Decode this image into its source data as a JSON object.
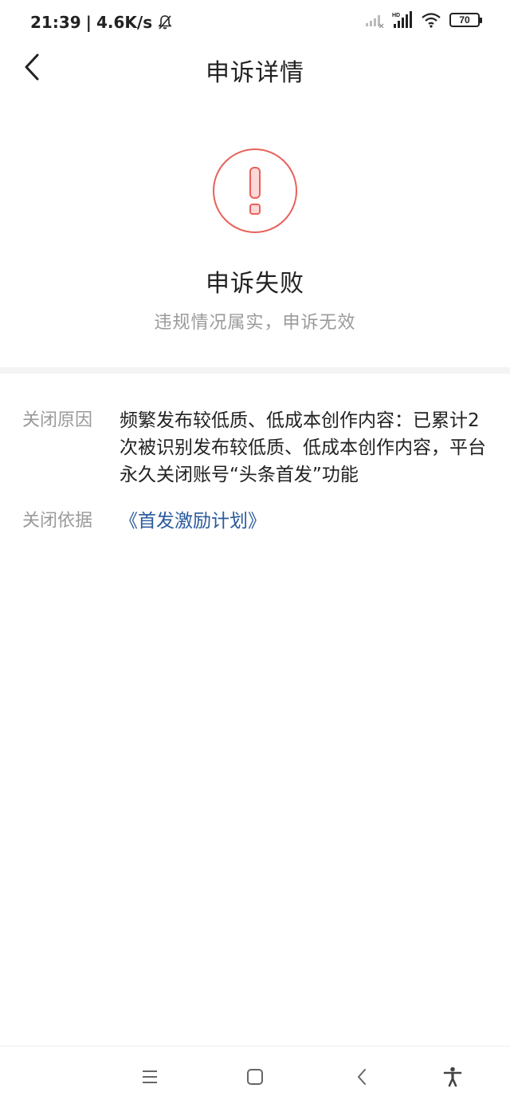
{
  "status_bar": {
    "time": "21:39",
    "separator": "|",
    "network_speed": "4.6K/s",
    "battery_level": "70",
    "icons": [
      "bell-off-icon",
      "signal-icon",
      "hd-signal-icon",
      "wifi-icon",
      "battery-icon"
    ]
  },
  "nav": {
    "title": "申诉详情",
    "back_icon": "chevron-left-icon"
  },
  "result": {
    "icon": "exclamation-icon",
    "title": "申诉失败",
    "subtitle": "违规情况属实，申诉无效",
    "accent_color": "#e8615c"
  },
  "details": {
    "reason_label": "关闭原因",
    "reason_text": "频繁发布较低质、低成本创作内容：已累计2次被识别发布较低质、低成本创作内容，平台永久关闭账号“头条首发”功能",
    "basis_label": "关闭依据",
    "basis_link": "《首发激励计划》",
    "link_color": "#2a5a9b"
  },
  "system_nav": {
    "icons": [
      "menu-icon",
      "home-icon",
      "back-icon",
      "accessibility-icon"
    ]
  }
}
